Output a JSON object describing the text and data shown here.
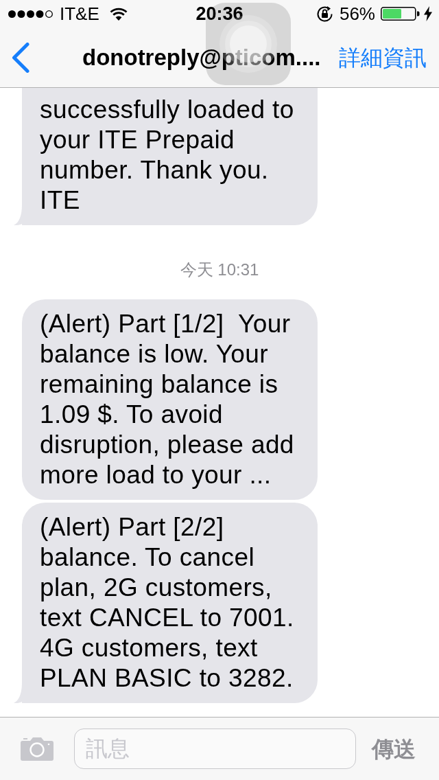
{
  "status_bar": {
    "carrier": "IT&E",
    "time": "20:36",
    "battery_percent": "56%"
  },
  "nav_bar": {
    "title": "donotreply@pticom....",
    "details_button": "詳細資訊"
  },
  "messages": [
    {
      "kind": "bubble",
      "cut_off_top": true,
      "tail": true,
      "lines": [
        "successfully loaded to",
        "your ITE Prepaid",
        "number. Thank you.",
        "ITE"
      ]
    },
    {
      "kind": "timestamp",
      "text": "今天 10:31"
    },
    {
      "kind": "bubble",
      "cut_off_top": false,
      "tail": false,
      "lines": [
        "(Alert) Part [1/2]  Your",
        "balance is low. Your",
        "remaining balance is",
        "1.09 $. To avoid",
        "disruption, please add",
        "more load to your ..."
      ]
    },
    {
      "kind": "bubble",
      "cut_off_top": false,
      "tail": true,
      "lines": [
        "(Alert) Part [2/2]",
        "balance. To cancel",
        "plan, 2G customers,",
        "text CANCEL to 7001.",
        "4G customers, text",
        "PLAN BASIC to 3282."
      ]
    }
  ],
  "input_bar": {
    "placeholder": "訊息",
    "send_button": {
      "label": "傳送",
      "disabled": true
    }
  }
}
